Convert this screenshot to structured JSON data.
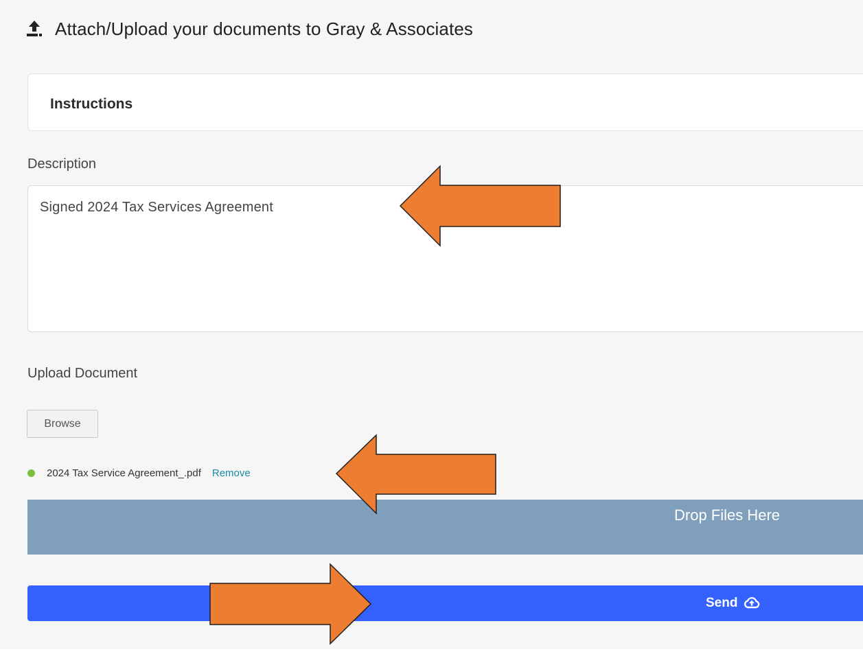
{
  "header": {
    "title": "Attach/Upload your documents to Gray & Associates",
    "icon": "upload-icon"
  },
  "instructions": {
    "title": "Instructions"
  },
  "description": {
    "label": "Description",
    "value": "Signed 2024 Tax Services Agreement"
  },
  "upload": {
    "label": "Upload Document",
    "browse_label": "Browse",
    "file": {
      "name": "2024 Tax Service Agreement_.pdf",
      "remove_label": "Remove",
      "status_color": "#7cbf3c"
    },
    "drop_label": "Drop Files Here"
  },
  "send": {
    "label": "Send",
    "icon": "cloud-upload-icon"
  },
  "colors": {
    "accent": "#3562ff",
    "drop_zone": "#7f9fbc",
    "annotation_arrow": "#ed7d31",
    "link": "#1a8aa6"
  }
}
